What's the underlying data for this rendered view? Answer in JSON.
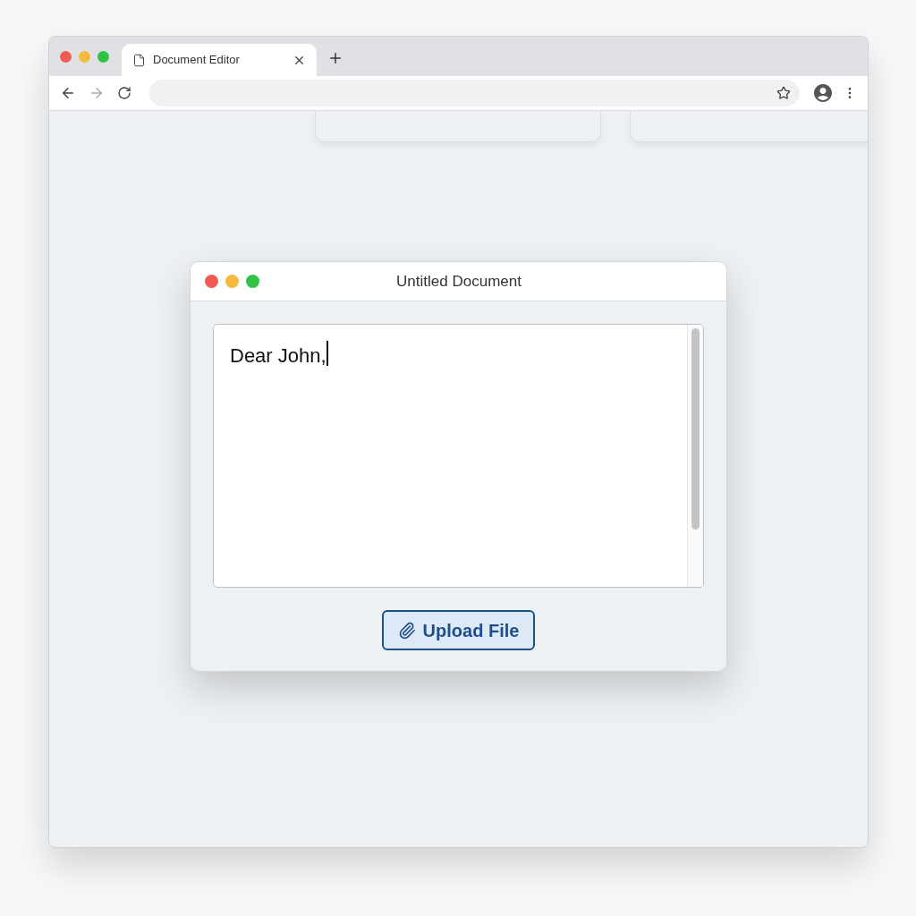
{
  "browser": {
    "tabs": [
      {
        "title": "Document Editor",
        "selected": true
      }
    ]
  },
  "editor_window": {
    "title": "Untitled Document",
    "text": "Dear John,",
    "upload_button": "Upload File"
  }
}
